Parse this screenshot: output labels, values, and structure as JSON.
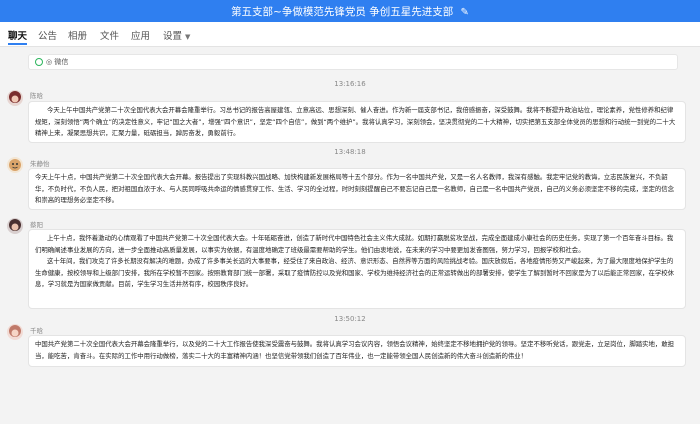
{
  "header": {
    "title": "第五支部~争做模范先锋党员 争创五星先进支部",
    "edit_icon": "✎"
  },
  "tabs": [
    {
      "label": "聊天",
      "active": true
    },
    {
      "label": "公告"
    },
    {
      "label": "相册"
    },
    {
      "label": "文件"
    },
    {
      "label": "应用"
    },
    {
      "label": "设置",
      "caret": "▼"
    }
  ],
  "notice": {
    "text": "◎ 微信"
  },
  "messages": [
    {
      "time": "13:16:16",
      "sender": "陈晗",
      "avatar_color": "#7a2d2d",
      "paragraphs": [
        "今天上午中国共产党第二十次全国代表大会开幕会隆重举行。习总书记的报告高屋建瓴、立意高远、思想深刻、催人奋进。作为新一届支部书记，我倍感振奋，深受鼓舞。我将不断提升政治站位，理论素养，党性修养和纪律规矩，深刻领悟“两个确立”的决定性意义，牢记“国之大者”，增强“四个意识”，坚定“四个自信”，做到“两个维护”。我将认真学习，深刻领会，坚决贯彻党的二十大精神，切实把第五支部全体党员的思想和行动统一到党的二十大精神上来，凝聚思想共识，汇聚力量，砥砺担当，踔厉奋发，勇毅前行。"
      ]
    },
    {
      "time": "13:48:18",
      "sender": "朱静怡",
      "avatar_color": "#d9a36a",
      "paragraphs": [
        "今天上午十点，中国共产党第二十次全国代表大会开幕。报告提出了实现科教兴国战略、加快构建新发展格局等十五个部分。作为一名中国共产党，又是一名人名教师，我深有感触。我定牢记党的教诲，立志民族复兴，不负韶华，不负时代，不负人民，把对祖国血浓于水、与人民同呼吸共命运的情感贯穿工作、生活、学习的全过程，时时刻刻提醒自己不要忘记自己是一名教师，自己是一名中国共产党员，自己的义务必须坚定不移的完成，坚定的信念和崇高的理想务必坚定不移。"
      ]
    },
    {
      "time": "",
      "sender": "蔡阳",
      "avatar_color": "#4a3030",
      "paragraphs": [
        "上午十点，我怀着激动的心情观看了中国共产党第二十次全国代表大会。十年砥砺奋进，创造了新时代中国特色社会主义伟大成就。如期打赢脱贫攻坚战，完成全面建成小康社会的历史任务，实现了第一个百年奋斗目标。我们明确阐述事业发展的方向，进一步全面推动高质量发展，以事实为依据，有温度地确定了班级最需要帮助的学生。他们由衷地说，在未来的学习中要更加发奋图强，努力学习，回报学校和社会。",
        "这十年间，我们攻克了许多长期没有解决的难题，办成了许多事关长远的大事要事，经受住了来自政治、经济、意识形态、自然界等方面的风险挑战考验。国庆放假后，各地疫情形势又严峻起来，为了最大限度地保护学生的生命健康，按校领导和上级部门安排，我所在学校暂不回家。按照教育部门统一部署，采取了疫情防控以及党和国家、学校为维持经济社会的正常运转做出的部署安排，使学生了解到暂时不回家是为了以后能正常回家，在学校休息，学习就是为国家做贡献。目前，学生学习生活井然有序，校园秩序良好。"
      ]
    },
    {
      "time": "13:50:12",
      "sender": "千晗",
      "avatar_color": "#c07a6a",
      "paragraphs": [
        "中国共产党第二十次全国代表大会开幕会隆重举行，以及党的二十大工作报告使我深受震奋与鼓舞。我将认真学习会议内容，领悟会议精神，始终坚定不移地拥护党的领导。坚定不移听党话，跟党走，立足岗位，脚踏实地，敢担当，能吃苦，肯奋斗。在实际的工作中用行动做榜，落实二十大的丰富精神内涵！也坚信党带领我们创造了百年伟业，也一定能带领全国人民创造新的伟大奋斗创造新的伟业！"
      ]
    }
  ]
}
